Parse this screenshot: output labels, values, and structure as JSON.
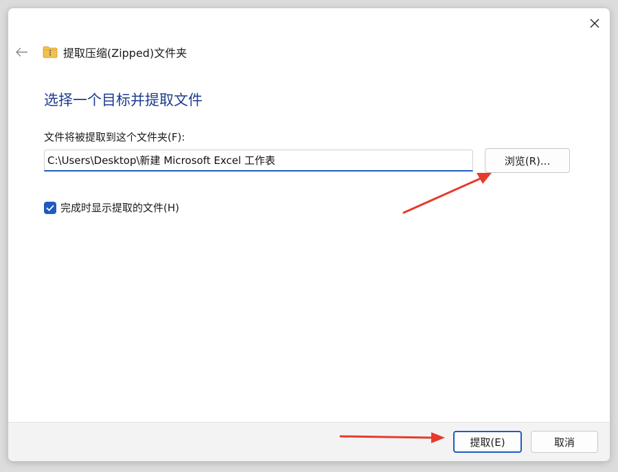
{
  "window": {
    "title": "提取压缩(Zipped)文件夹"
  },
  "heading": "选择一个目标并提取文件",
  "destination": {
    "label": "文件将被提取到这个文件夹(F):",
    "path": "C:\\Users\\Desktop\\新建 Microsoft Excel 工作表",
    "browse_label": "浏览(R)..."
  },
  "option": {
    "label": "完成时显示提取的文件(H)",
    "checked": true
  },
  "footer": {
    "extract_label": "提取(E)",
    "cancel_label": "取消"
  },
  "icons": {
    "close": "close-icon",
    "back": "back-arrow-icon",
    "folder": "zip-folder-icon",
    "check": "checkmark-icon"
  },
  "colors": {
    "accent": "#1f5bbf",
    "heading": "#1c3c8c",
    "annotation_arrow": "#e8392b",
    "folder": "#f2c14e"
  }
}
